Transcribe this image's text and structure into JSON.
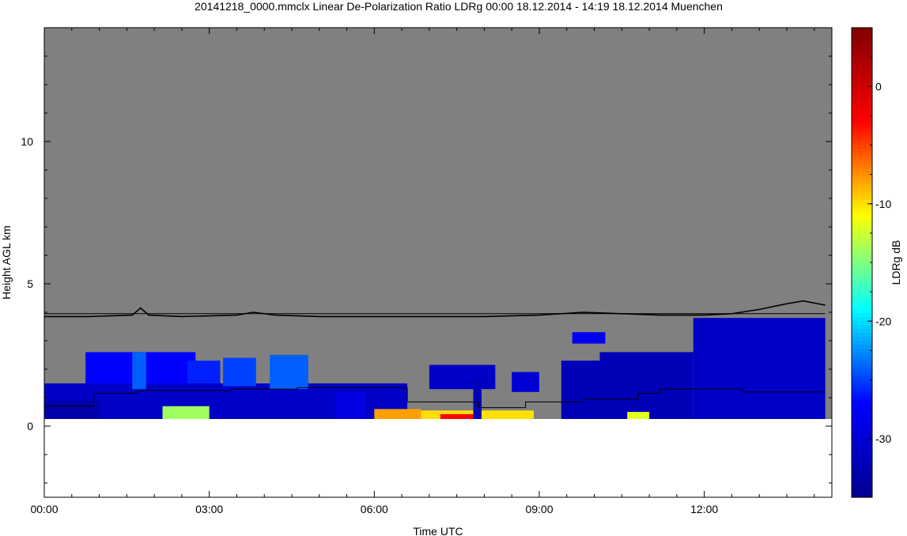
{
  "chart_data": {
    "type": "heatmap",
    "title": "20141218_0000.mmclx Linear De-Polarization Ratio LDRg   00:00 18.12.2014 - 14:19 18.12.2014 Muenchen",
    "xlabel": "Time UTC",
    "ylabel": "Height AGL km",
    "xlim": [
      0,
      14.32
    ],
    "ylim": [
      -2.5,
      14
    ],
    "x_ticks": [
      {
        "value": 0,
        "label": "00:00"
      },
      {
        "value": 3,
        "label": "03:00"
      },
      {
        "value": 6,
        "label": "06:00"
      },
      {
        "value": 9,
        "label": "09:00"
      },
      {
        "value": 12,
        "label": "12:00"
      }
    ],
    "y_ticks": [
      {
        "value": 0,
        "label": "0"
      },
      {
        "value": 5,
        "label": "5"
      },
      {
        "value": 10,
        "label": "10"
      }
    ],
    "colorbar": {
      "label": "LDRg dB",
      "range": [
        -35,
        5
      ],
      "ticks": [
        {
          "value": 0,
          "label": "0"
        },
        {
          "value": -10,
          "label": "-10"
        },
        {
          "value": -20,
          "label": "-20"
        },
        {
          "value": -30,
          "label": "-30"
        }
      ],
      "colormap": [
        "#00008f",
        "#0000ff",
        "#00ffff",
        "#ffff00",
        "#ff0000",
        "#800000"
      ]
    },
    "background_color": "#808080",
    "below_ground_color": "#ffffff",
    "data_top_height_km": 0.25,
    "echo_regions": [
      {
        "x": [
          0.0,
          6.6
        ],
        "y": [
          0.25,
          1.5
        ],
        "ldr": -31
      },
      {
        "x": [
          0.0,
          1.0
        ],
        "y": [
          0.25,
          0.9
        ],
        "ldr": -33
      },
      {
        "x": [
          0.75,
          2.75
        ],
        "y": [
          1.5,
          2.6
        ],
        "ldr": -27
      },
      {
        "x": [
          1.6,
          1.85
        ],
        "y": [
          1.3,
          2.6
        ],
        "ldr": -24
      },
      {
        "x": [
          2.6,
          3.2
        ],
        "y": [
          1.5,
          2.3
        ],
        "ldr": -26
      },
      {
        "x": [
          3.25,
          3.85
        ],
        "y": [
          1.4,
          2.4
        ],
        "ldr": -25
      },
      {
        "x": [
          4.1,
          4.8
        ],
        "y": [
          1.3,
          2.5
        ],
        "ldr": -24
      },
      {
        "x": [
          2.15,
          3.0
        ],
        "y": [
          0.25,
          0.7
        ],
        "ldr": -14
      },
      {
        "x": [
          5.3,
          5.85
        ],
        "y": [
          0.25,
          1.2
        ],
        "ldr": -29
      },
      {
        "x": [
          6.0,
          6.85
        ],
        "y": [
          0.25,
          0.6
        ],
        "ldr": -8
      },
      {
        "x": [
          6.85,
          8.9
        ],
        "y": [
          0.25,
          0.55
        ],
        "ldr": -10
      },
      {
        "x": [
          7.2,
          7.9
        ],
        "y": [
          0.25,
          0.42
        ],
        "ldr": -3
      },
      {
        "x": [
          7.0,
          8.2
        ],
        "y": [
          1.3,
          2.15
        ],
        "ldr": -31
      },
      {
        "x": [
          7.8,
          7.95
        ],
        "y": [
          0.25,
          1.6
        ],
        "ldr": -32
      },
      {
        "x": [
          8.5,
          9.0
        ],
        "y": [
          1.2,
          1.9
        ],
        "ldr": -30
      },
      {
        "x": [
          9.4,
          10.3
        ],
        "y": [
          0.25,
          2.3
        ],
        "ldr": -32
      },
      {
        "x": [
          10.1,
          11.8
        ],
        "y": [
          0.25,
          2.6
        ],
        "ldr": -32
      },
      {
        "x": [
          10.6,
          11.0
        ],
        "y": [
          0.25,
          0.5
        ],
        "ldr": -12
      },
      {
        "x": [
          11.8,
          14.2
        ],
        "y": [
          0.25,
          3.8
        ],
        "ldr": -31
      },
      {
        "x": [
          9.6,
          10.2
        ],
        "y": [
          2.9,
          3.3
        ],
        "ldr": -28
      }
    ],
    "series": [
      {
        "style": "black-noisy-line",
        "x": [
          0,
          0.8,
          1.6,
          1.75,
          1.9,
          2.5,
          3.5,
          3.8,
          4.2,
          5.0,
          6.0,
          7.0,
          8.0,
          9.0,
          9.8,
          10.5,
          11.2,
          12.0,
          12.5,
          13.0,
          13.5,
          13.8,
          14.2
        ],
        "y": [
          3.85,
          3.85,
          3.9,
          4.15,
          3.9,
          3.85,
          3.9,
          4.0,
          3.9,
          3.85,
          3.85,
          3.85,
          3.85,
          3.9,
          4.0,
          3.95,
          3.9,
          3.9,
          3.95,
          4.1,
          4.3,
          4.4,
          4.25
        ]
      },
      {
        "style": "black-step-line",
        "x": [
          0,
          0.9,
          0.9,
          1.7,
          1.7,
          3.4,
          3.4,
          4.6,
          4.6,
          6.6,
          6.6,
          7.9,
          7.9,
          8.75,
          8.75,
          9.8,
          9.8,
          10.8,
          10.8,
          11.2,
          11.2,
          12.7,
          12.7,
          14.2
        ],
        "y": [
          0.7,
          0.7,
          1.15,
          1.15,
          1.25,
          1.25,
          1.3,
          1.3,
          1.35,
          1.35,
          0.85,
          0.85,
          0.65,
          0.65,
          0.85,
          0.85,
          0.95,
          0.95,
          1.15,
          1.15,
          1.3,
          1.3,
          1.2,
          1.2
        ]
      },
      {
        "style": "black-flat-line",
        "x": [
          0,
          14.2
        ],
        "y": [
          3.95,
          3.95
        ]
      }
    ]
  }
}
